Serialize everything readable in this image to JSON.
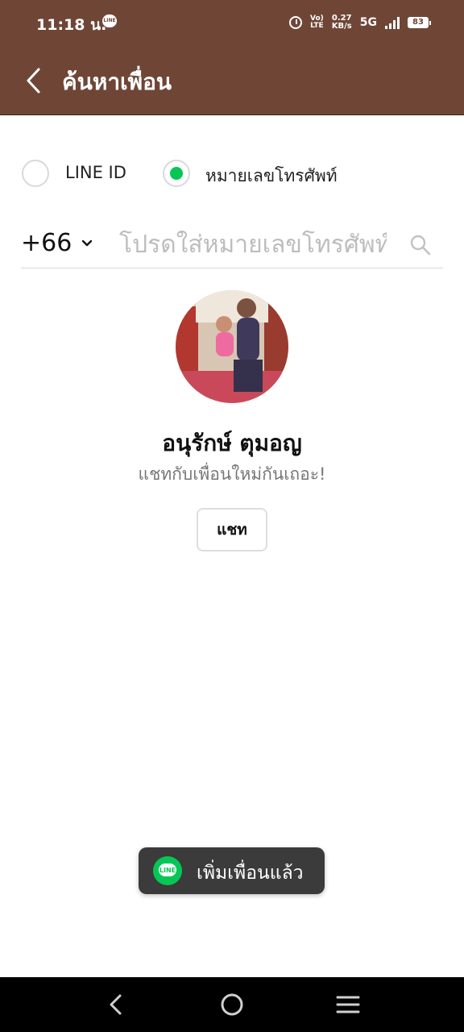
{
  "status_bar": {
    "time": "11:18 น.",
    "app_icon": "line-icon",
    "app_icon_label": "LINE",
    "alarm_icon": "alarm-icon",
    "volte_top": "Vo)",
    "volte_bottom": "LTE",
    "speed_value": "0.27",
    "speed_unit": "KB/s",
    "network": "5G",
    "signal_icon": "signal-icon",
    "battery": "83"
  },
  "header": {
    "back_icon": "chevron-left-icon",
    "title": "ค้นหาเพื่อน",
    "background": "#6f4636"
  },
  "search_mode": {
    "options": [
      {
        "label": "LINE ID",
        "selected": false
      },
      {
        "label": "หมายเลขโทรศัพท์",
        "selected": true
      }
    ],
    "accent": "#06c755"
  },
  "phone_search": {
    "country_code": "+66",
    "dropdown_icon": "chevron-down-icon",
    "value": "",
    "placeholder": "โปรดใส่หมายเลขโทรศัพท์",
    "search_icon": "search-icon"
  },
  "profile": {
    "avatar": "avatar-photo",
    "name": "อนุรักษ์ ตุมอญ",
    "status_message": "แชทกับเพื่อนใหม่กันเถอะ!",
    "chat_button": "แชท"
  },
  "toast": {
    "icon": "line-logo-icon",
    "icon_label": "LINE",
    "message": "เพิ่มเพื่อนแล้ว"
  },
  "navigation_bar": {
    "back": "nav-back-icon",
    "home": "nav-home-icon",
    "menu": "nav-menu-icon"
  }
}
